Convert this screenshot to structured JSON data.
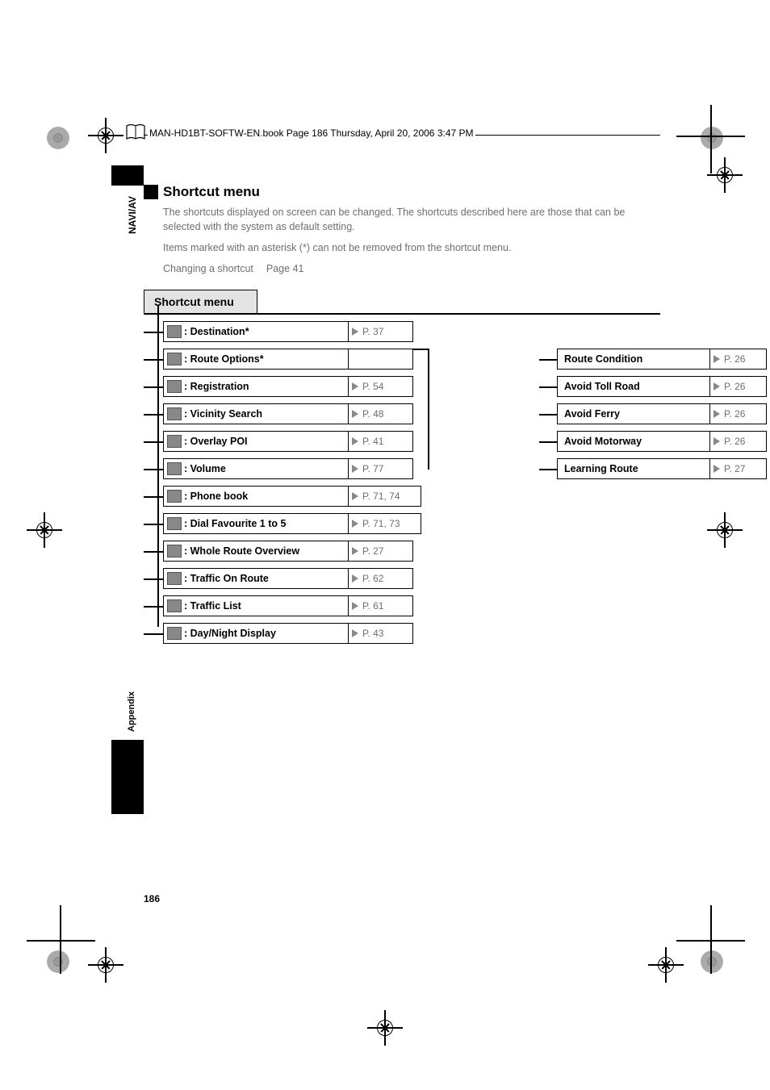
{
  "header_line": "MAN-HD1BT-SOFTW-EN.book  Page 186  Thursday, April 20, 2006  3:47 PM",
  "side_label_top": "NAVI/AV",
  "side_label_bottom": "Appendix",
  "title": "Shortcut menu",
  "para1": "The shortcuts displayed on screen can be changed. The shortcuts described here are those that can be selected with the system as default setting.",
  "para2": "Items marked with an asterisk (*) can not be removed from the shortcut menu.",
  "para3a": "Changing a shortcut",
  "para3b": "Page 41",
  "section_tab": "Shortcut menu",
  "items": [
    {
      "label": ": Destination*",
      "page": "P. 37"
    },
    {
      "label": ": Route Options*",
      "page": ""
    },
    {
      "label": ": Registration",
      "page": "P. 54"
    },
    {
      "label": ": Vicinity Search",
      "page": "P. 48"
    },
    {
      "label": ": Overlay POI",
      "page": "P. 41"
    },
    {
      "label": ": Volume",
      "page": "P. 77"
    },
    {
      "label": ": Phone book",
      "page": "P. 71, 74"
    },
    {
      "label": ": Dial Favourite 1 to 5",
      "page": "P. 71, 73"
    },
    {
      "label": ": Whole Route Overview",
      "page": "P. 27"
    },
    {
      "label": ": Traffic On Route",
      "page": "P. 62"
    },
    {
      "label": ": Traffic List",
      "page": "P. 61"
    },
    {
      "label": ": Day/Night Display",
      "page": "P. 43"
    }
  ],
  "sub_items": [
    {
      "label": "Route Condition",
      "page": "P. 26"
    },
    {
      "label": "Avoid Toll Road",
      "page": "P. 26"
    },
    {
      "label": "Avoid Ferry",
      "page": "P. 26"
    },
    {
      "label": "Avoid Motorway",
      "page": "P. 26"
    },
    {
      "label": "Learning Route",
      "page": "P. 27"
    }
  ],
  "page_number": "186"
}
